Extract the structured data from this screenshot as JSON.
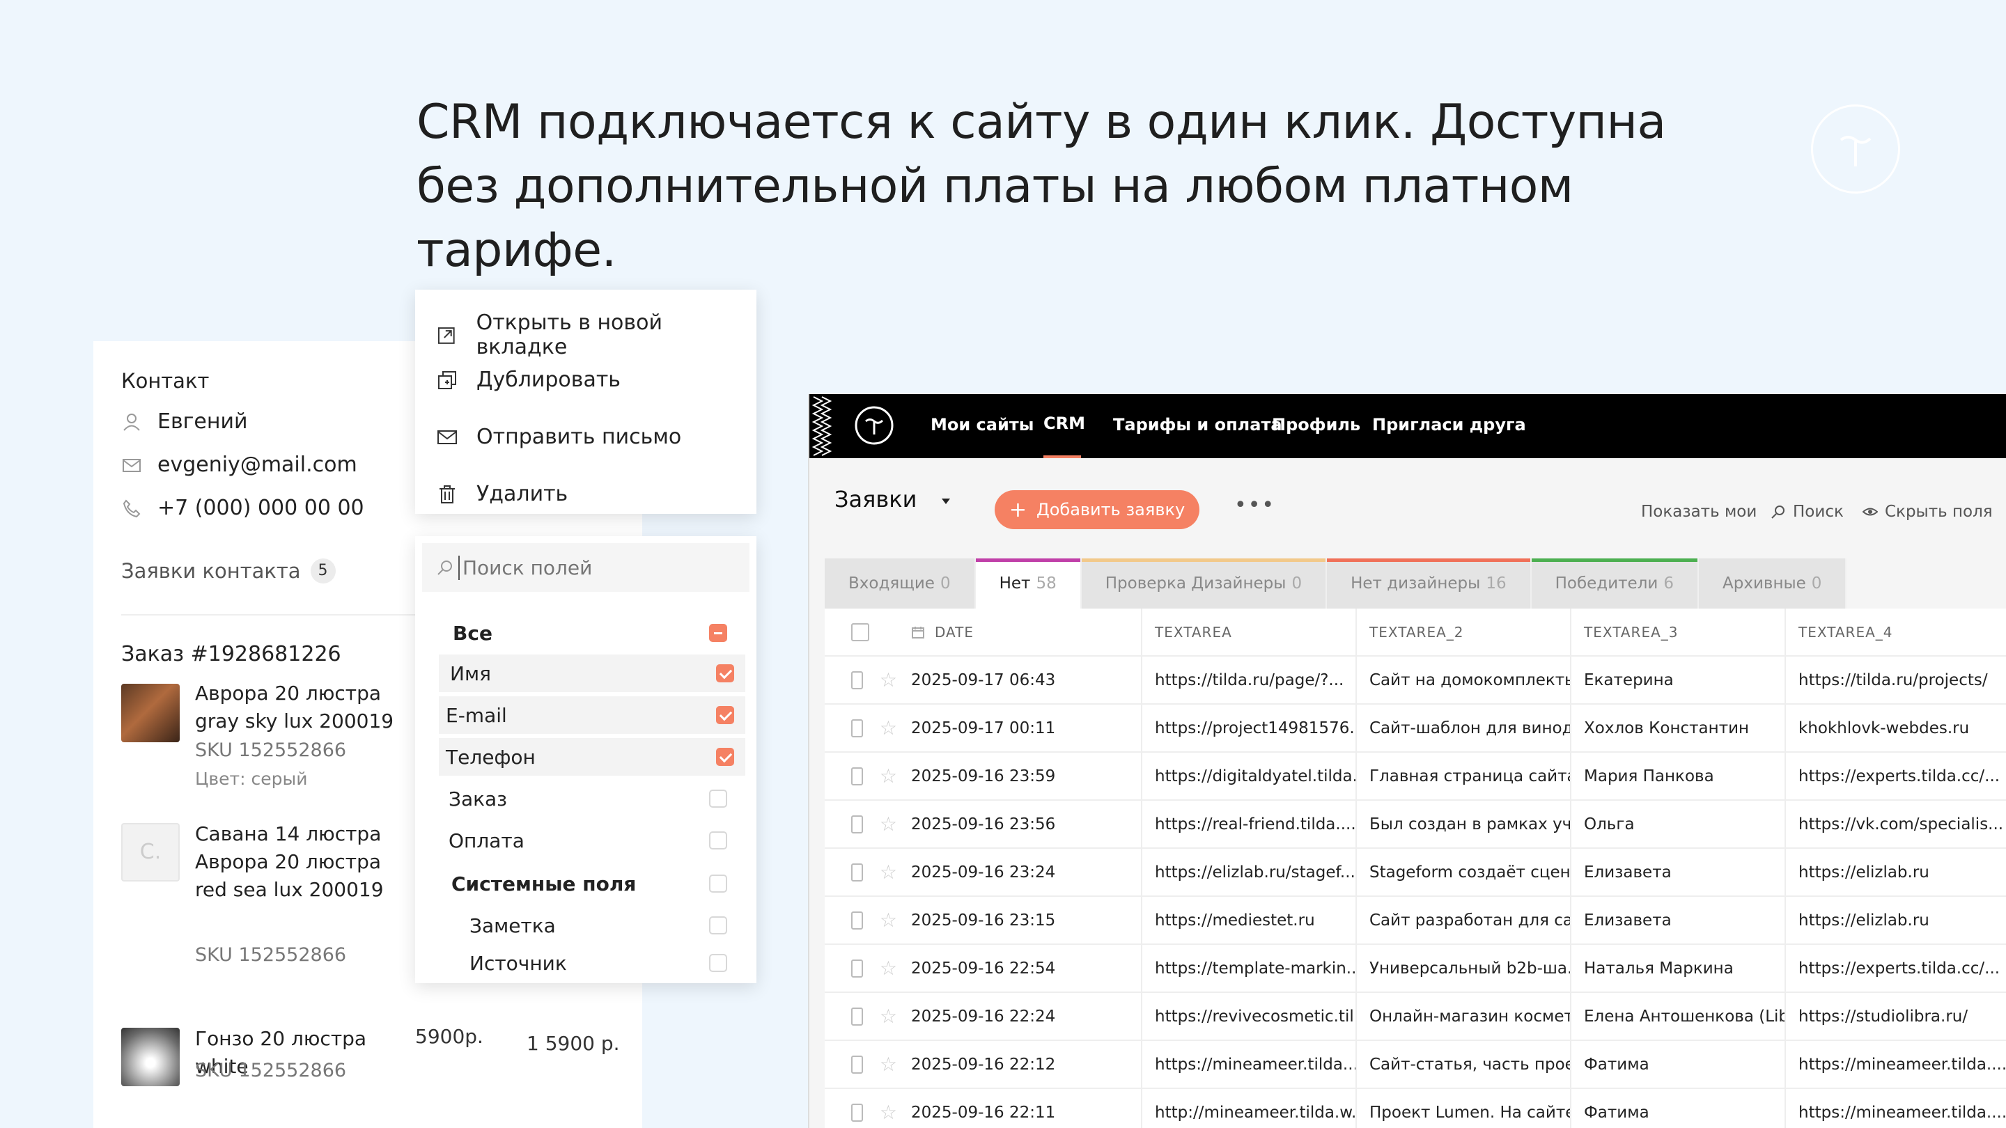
{
  "headline": {
    "line1": "CRM подключается к сайту в один клик. Доступна",
    "line2": "без дополнительной платы на любом платном тарифе."
  },
  "contact": {
    "title": "Контакт",
    "name": "Евгений",
    "email": "evgeniy@mail.com",
    "phone": "+7 (000) 000 00 00",
    "requests_label": "Заявки контакта",
    "requests_count": "5",
    "order_title": "Заказ  #1928681226",
    "products": [
      {
        "name": "Аврора 20 люстра gray sky lux 200019",
        "sku": "SKU 152552866",
        "color": "Цвет: серый"
      },
      {
        "placeholder": "C.",
        "name": "Савана 14 люстра Аврора 20 люстра red sea lux 200019",
        "sku": "SKU 152552866"
      },
      {
        "name": "Гонзо 20 люстра white",
        "sku": "SKU 152552866",
        "price": "5900р.",
        "qty_price": "1  5900 р."
      }
    ]
  },
  "context_menu": {
    "items": [
      "Открыть в новой вкладке",
      "Дублировать",
      "Отправить письмо",
      "Удалить"
    ]
  },
  "fields_panel": {
    "search_placeholder": "Поиск полей",
    "all": "Все",
    "items": [
      "Имя",
      "E-mail",
      "Телефон",
      "Заказ",
      "Оплата"
    ],
    "system_label": "Системные поля",
    "system_items": [
      "Заметка",
      "Источник"
    ]
  },
  "crm": {
    "nav": [
      "Мои сайты",
      "CRM",
      "Тарифы и оплата",
      "Профиль",
      "Пригласи друга"
    ],
    "page_title": "Заявки",
    "add_button": "Добавить заявку",
    "more": "•••",
    "tools": [
      "Показать мои",
      "Поиск",
      "Скрыть поля"
    ],
    "tabs": [
      {
        "label": "Входящие",
        "count": "0",
        "color": ""
      },
      {
        "label": "Нет",
        "count": "58",
        "color": "#c03fa8"
      },
      {
        "label": "Проверка Дизайнеры",
        "count": "0",
        "color": "#f2c98a"
      },
      {
        "label": "Нет дизайнеры",
        "count": "16",
        "color": "#f07058"
      },
      {
        "label": "Победители",
        "count": "6",
        "color": "#4caf50"
      },
      {
        "label": "Архивные",
        "count": "0",
        "color": ""
      }
    ],
    "columns": [
      "DATE",
      "TEXTAREA",
      "TEXTAREA_2",
      "TEXTAREA_3",
      "TEXTAREA_4"
    ],
    "rows": [
      [
        "2025-09-17 06:43",
        "https://tilda.ru/page/?...",
        "Сайт на домокомплекты...",
        "Екатерина",
        "https://tilda.ru/projects/"
      ],
      [
        "2025-09-17 00:11",
        "https://project14981576...",
        "Сайт-шаблон для винод...",
        "Хохлов Константин",
        "khokhlovk-webdes.ru"
      ],
      [
        "2025-09-16 23:59",
        "https://digitaldyatel.tilda...",
        "Главная страница сайта ...",
        "Мария Панкова",
        "https://experts.tilda.cc/..."
      ],
      [
        "2025-09-16 23:56",
        "https://real-friend.tilda....",
        "Был создан в рамках уч...",
        "Ольга",
        "https://vk.com/specialis..."
      ],
      [
        "2025-09-16 23:24",
        "https://elizlab.ru/stagef...",
        "Stageform создаёт сцен...",
        "Елизавета",
        "https://elizlab.ru"
      ],
      [
        "2025-09-16 23:15",
        "https://mediestet.ru",
        "Сайт разработан для са...",
        "Елизавета",
        "https://elizlab.ru"
      ],
      [
        "2025-09-16 22:54",
        "https://template-markin...",
        "Универсальный b2b-ша...",
        "Наталья Маркина",
        "https://experts.tilda.cc/..."
      ],
      [
        "2025-09-16 22:24",
        "https://revivecosmetic.til...",
        "Онлайн-магазин космет...",
        "Елена Антошенкова (Lib...",
        "https://studiolibra.ru/"
      ],
      [
        "2025-09-16 22:12",
        "https://mineameer.tilda....",
        "Сайт-статья, часть прое...",
        "Фатима",
        "https://mineameer.tilda...."
      ],
      [
        "2025-09-16 22:11",
        "http://mineameer.tilda.w...",
        "Проект Lumen. На сайте...",
        "Фатима",
        "https://mineameer.tilda...."
      ]
    ]
  }
}
